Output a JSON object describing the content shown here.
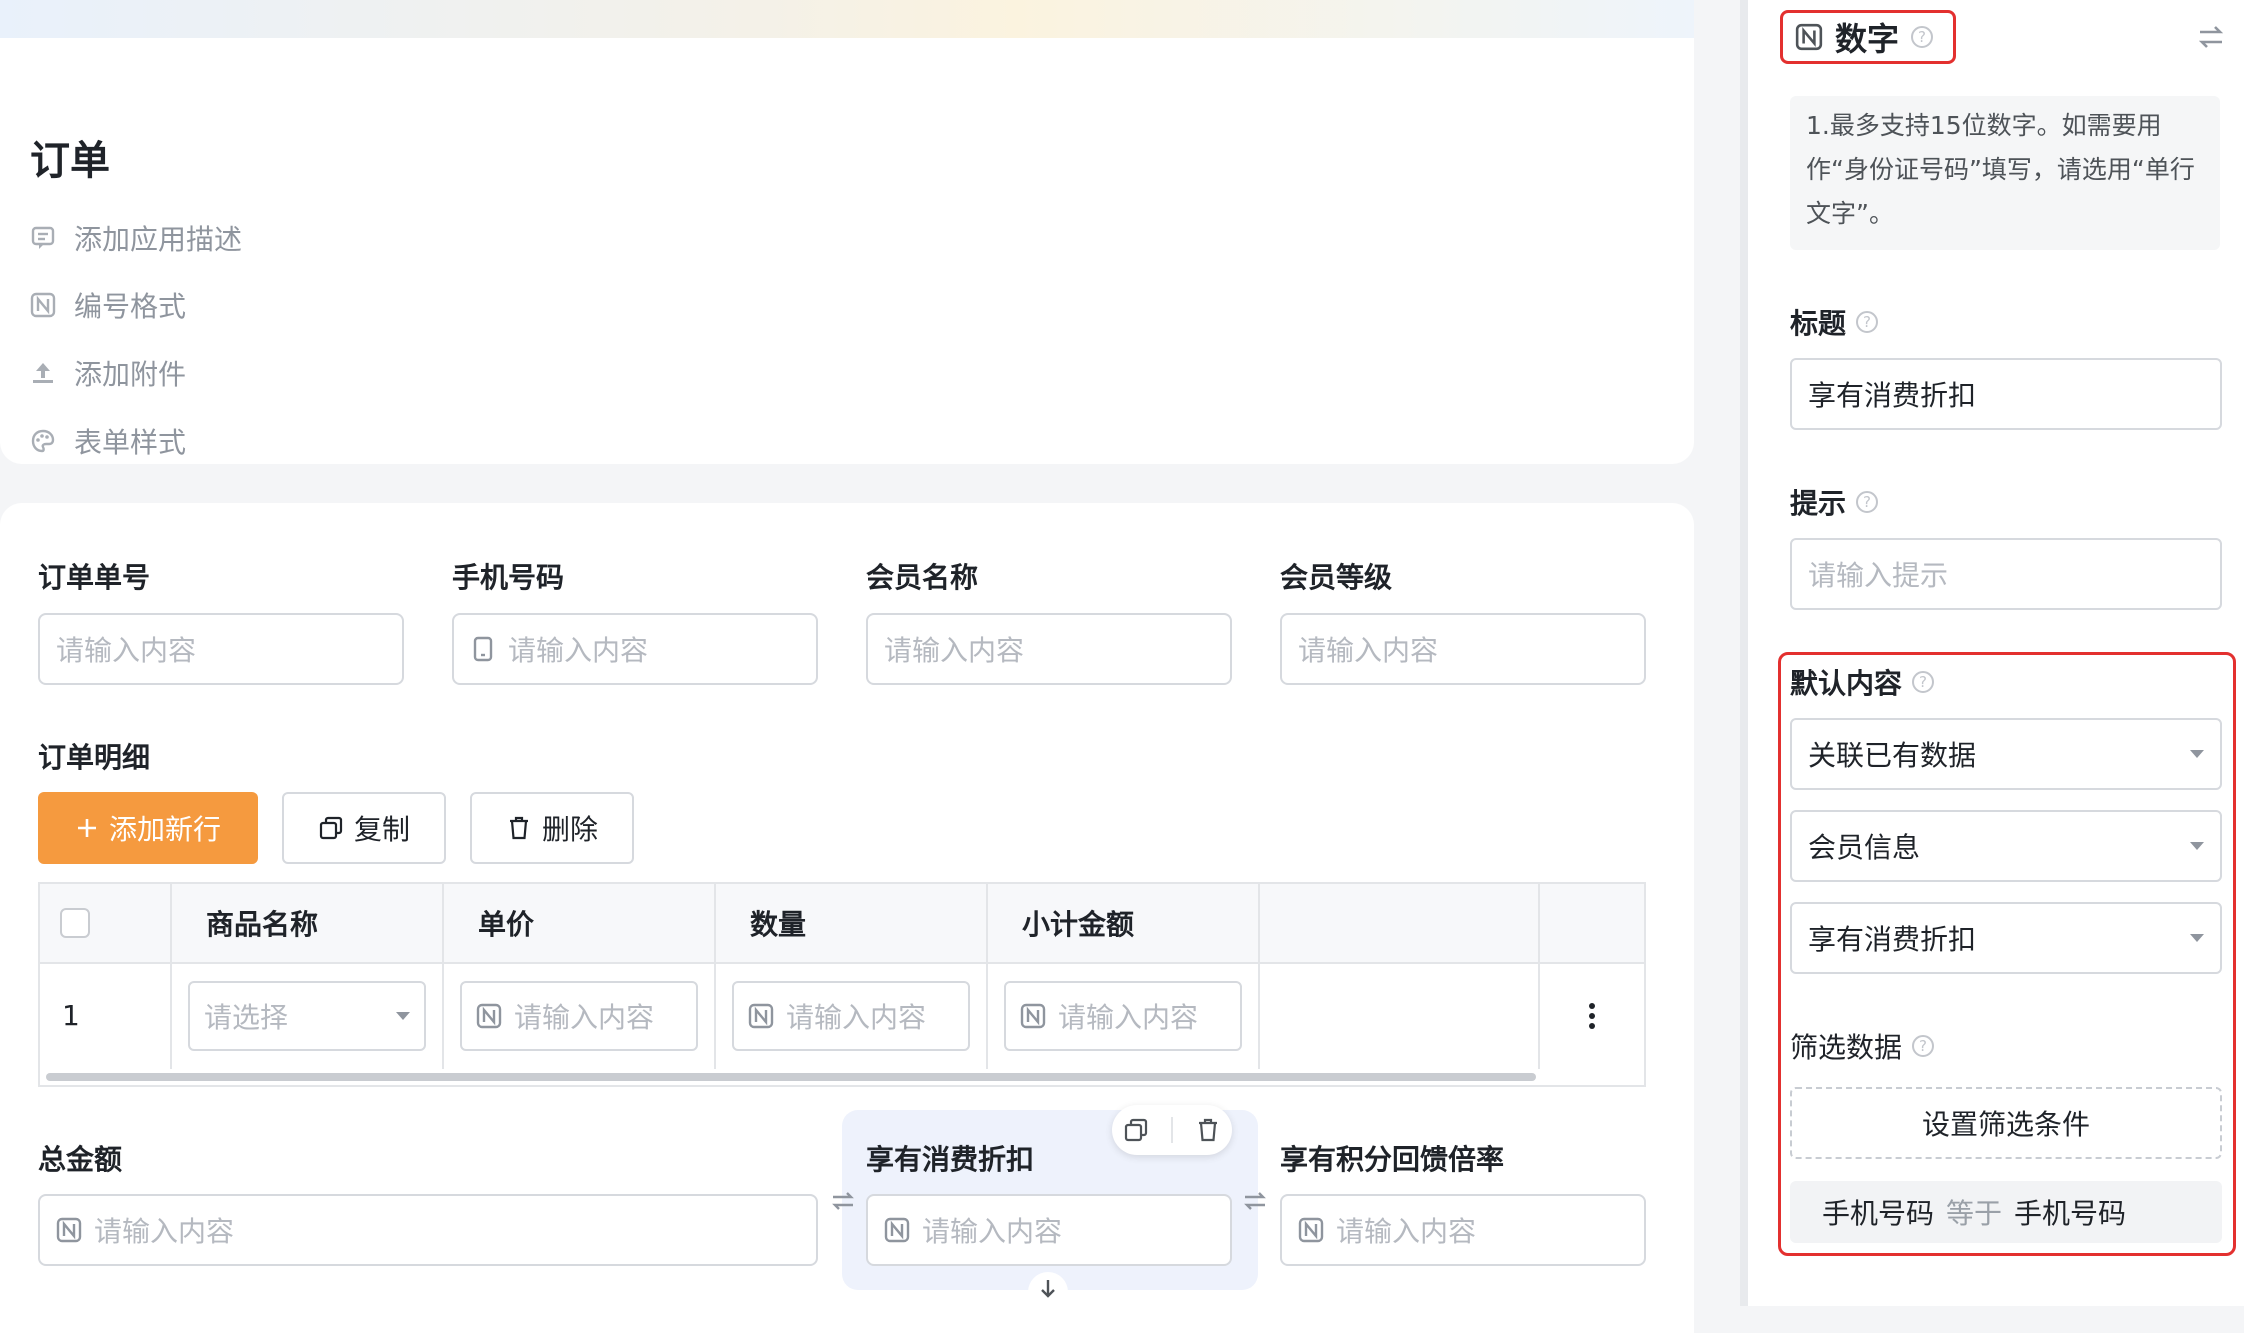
{
  "app": {
    "title": "订单",
    "meta_items": [
      {
        "label": "添加应用描述",
        "icon": "comment-icon"
      },
      {
        "label": "编号格式",
        "icon": "number-icon"
      },
      {
        "label": "添加附件",
        "icon": "upload-icon"
      },
      {
        "label": "表单样式",
        "icon": "palette-icon"
      }
    ]
  },
  "form": {
    "row1": [
      {
        "label": "订单单号",
        "placeholder": "请输入内容"
      },
      {
        "label": "手机号码",
        "placeholder": "请输入内容"
      },
      {
        "label": "会员名称",
        "placeholder": "请输入内容"
      },
      {
        "label": "会员等级",
        "placeholder": "请输入内容"
      }
    ],
    "detail": {
      "label": "订单明细",
      "buttons": {
        "add": "添加新行",
        "copy": "复制",
        "delete": "删除"
      },
      "columns": [
        "商品名称",
        "单价",
        "数量",
        "小计金额"
      ],
      "row": {
        "index": "1",
        "select_placeholder": "请选择",
        "placeholder": "请输入内容"
      }
    },
    "row3": [
      {
        "label": "总金额",
        "placeholder": "请输入内容"
      },
      {
        "label": "享有消费折扣",
        "placeholder": "请输入内容"
      },
      {
        "label": "享有积分回馈倍率",
        "placeholder": "请输入内容"
      }
    ]
  },
  "panel": {
    "type_title": "数字",
    "tip": "1.最多支持15位数字。如需要用作“身份证号码”填写，请选用“单行文字”。",
    "title_label": "标题",
    "title_value": "享有消费折扣",
    "hint_label": "提示",
    "hint_placeholder": "请输入提示",
    "default_label": "默认内容",
    "default_mode": "关联已有数据",
    "source_form": "会员信息",
    "source_field": "享有消费折扣",
    "filter_label": "筛选数据",
    "filter_button": "设置筛选条件",
    "condition": {
      "left": "手机号码",
      "op": "等于",
      "right": "手机号码"
    }
  },
  "colors": {
    "accent": "#f59a3f",
    "highlight": "#e3302f",
    "selected_bg": "#eef2fc"
  }
}
